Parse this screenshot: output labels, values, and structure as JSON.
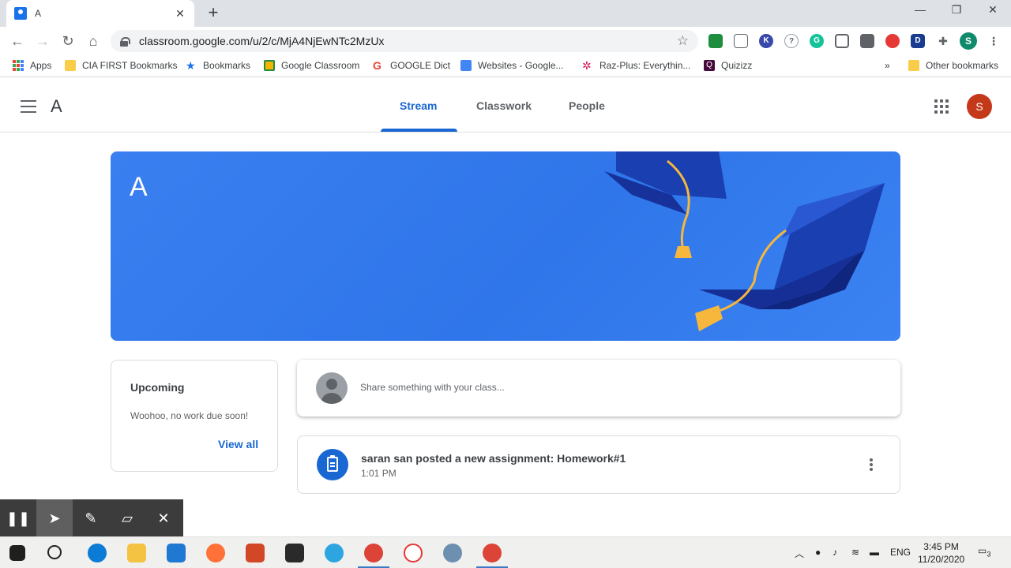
{
  "browser": {
    "tab_title": "A",
    "tab_close": "✕",
    "new_tab": "+",
    "url": "classroom.google.com/u/2/c/MjA4NjEwNTc2MzUx",
    "profile_initial": "S",
    "bookmarks": [
      {
        "label": "Apps"
      },
      {
        "label": "CIA FIRST Bookmarks"
      },
      {
        "label": "Bookmarks"
      },
      {
        "label": "Google Classroom"
      },
      {
        "label": "GOOGLE Dict"
      },
      {
        "label": "Websites - Google..."
      },
      {
        "label": "Raz-Plus: Everythin..."
      },
      {
        "label": "Quizizz"
      }
    ],
    "bookmarks_overflow": "»",
    "other_bookmarks": "Other bookmarks"
  },
  "classroom": {
    "class_letter": "A",
    "tabs": [
      {
        "label": "Stream",
        "active": true
      },
      {
        "label": "Classwork",
        "active": false
      },
      {
        "label": "People",
        "active": false
      }
    ],
    "account_initial": "S",
    "banner_title": "A",
    "upcoming": {
      "title": "Upcoming",
      "message": "Woohoo, no work due soon!",
      "view_all": "View all"
    },
    "share_placeholder": "Share something with your class...",
    "post": {
      "title": "saran san posted a new assignment: Homework#1",
      "time": "1:01 PM"
    }
  },
  "annotation_toolbar": {
    "icons": [
      "pause-icon",
      "pointer-icon",
      "pen-icon",
      "eraser-icon",
      "close-icon"
    ]
  },
  "taskbar": {
    "language": "ENG",
    "time": "3:45 PM",
    "date": "11/20/2020",
    "notifications": "3"
  },
  "colors": {
    "accent": "#1967d2",
    "banner": "#3a7ff0",
    "avatar": "#c5391b"
  }
}
